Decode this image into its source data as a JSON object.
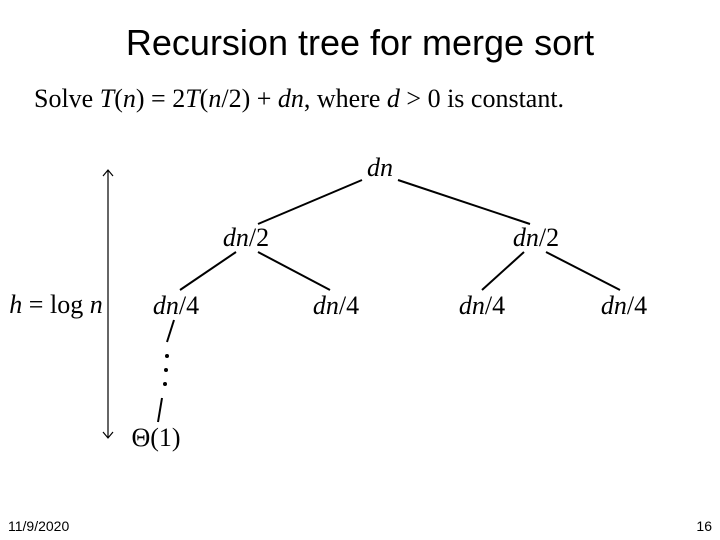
{
  "title": "Recursion tree for merge sort",
  "subtitle_parts": {
    "p1": "Solve ",
    "p2": "T",
    "p3": "(",
    "p4": "n",
    "p5": ") = 2",
    "p6": "T",
    "p7": "(",
    "p8": "n",
    "p9": "/2) + ",
    "p10": "dn",
    "p11": ", where ",
    "p12": "d",
    "p13": " > 0 is constant."
  },
  "tree": {
    "root_d": "dn",
    "l1_left_d": "dn",
    "l1_left_s": "/2",
    "l1_right_d": "dn",
    "l1_right_s": "/2",
    "l2_1_d": "dn",
    "l2_1_s": "/4",
    "l2_2_d": "dn",
    "l2_2_s": "/4",
    "l2_3_d": "dn",
    "l2_3_s": "/4",
    "l2_4_d": "dn",
    "l2_4_s": "/4",
    "leaf": "Θ(1)"
  },
  "height_label": {
    "h": "h",
    "eq": " = log ",
    "n": "n"
  },
  "footer": {
    "date": "11/9/2020",
    "page": "16"
  }
}
